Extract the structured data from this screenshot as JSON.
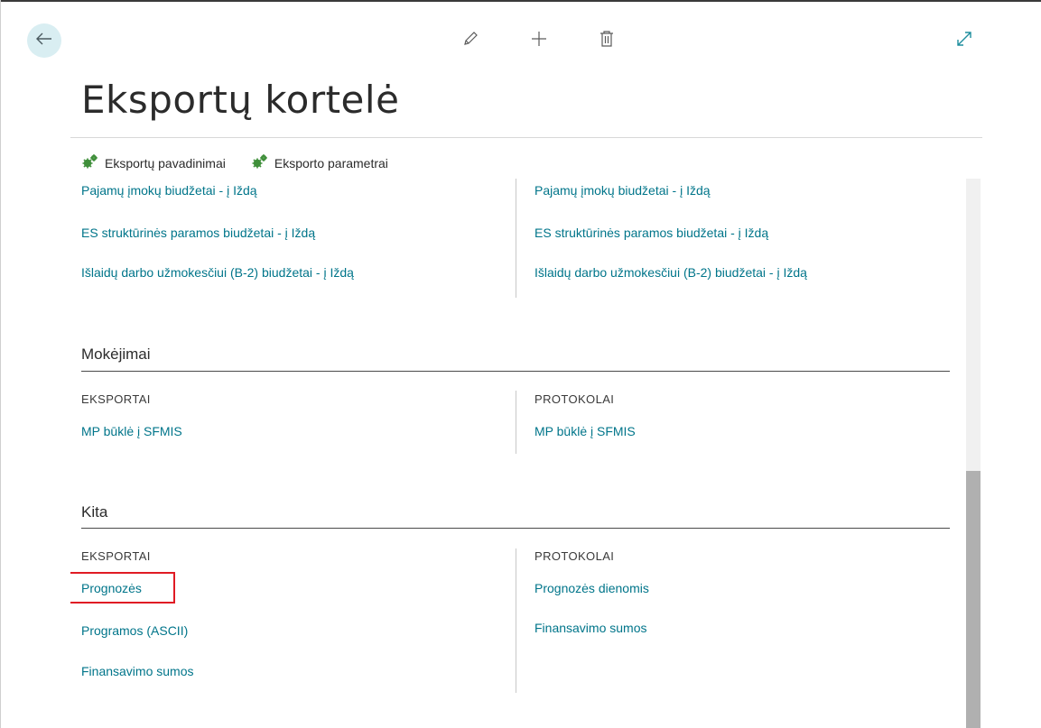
{
  "page": {
    "title": "Eksportų kortelė"
  },
  "toolbar": {
    "icons": [
      "edit-icon",
      "add-icon",
      "delete-icon",
      "expand-icon",
      "back-arrow-icon"
    ]
  },
  "actions": [
    {
      "label": "Eksportų pavadinimai",
      "icon": "gears-icon"
    },
    {
      "label": "Eksporto parametrai",
      "icon": "gears-icon"
    }
  ],
  "top_section": {
    "left_links": [
      "Pajamų įmokų biudžetai - į Iždą",
      "ES struktūrinės paramos biudžetai - į Iždą",
      "Išlaidų darbo užmokesčiui (B-2) biudžetai - į Iždą"
    ],
    "right_links": [
      "Pajamų įmokų biudžetai - į Iždą",
      "ES struktūrinės paramos biudžetai - į Iždą",
      "Išlaidų darbo užmokesčiui (B-2) biudžetai - į Iždą"
    ]
  },
  "mokejimai": {
    "title": "Mokėjimai",
    "left_header": "EKSPORTAI",
    "right_header": "PROTOKOLAI",
    "left_links": [
      "MP būklė į SFMIS"
    ],
    "right_links": [
      "MP būklė į SFMIS"
    ]
  },
  "kita": {
    "title": "Kita",
    "left_header": "EKSPORTAI",
    "right_header": "PROTOKOLAI",
    "left_links": [
      "Prognozės",
      "Programos (ASCII)",
      "Finansavimo sumos"
    ],
    "right_links": [
      "Prognozės dienomis",
      "Finansavimo sumos"
    ]
  },
  "colors": {
    "link": "#00758a",
    "highlight": "#e01b24",
    "back_button_bg": "#d9eef2"
  }
}
